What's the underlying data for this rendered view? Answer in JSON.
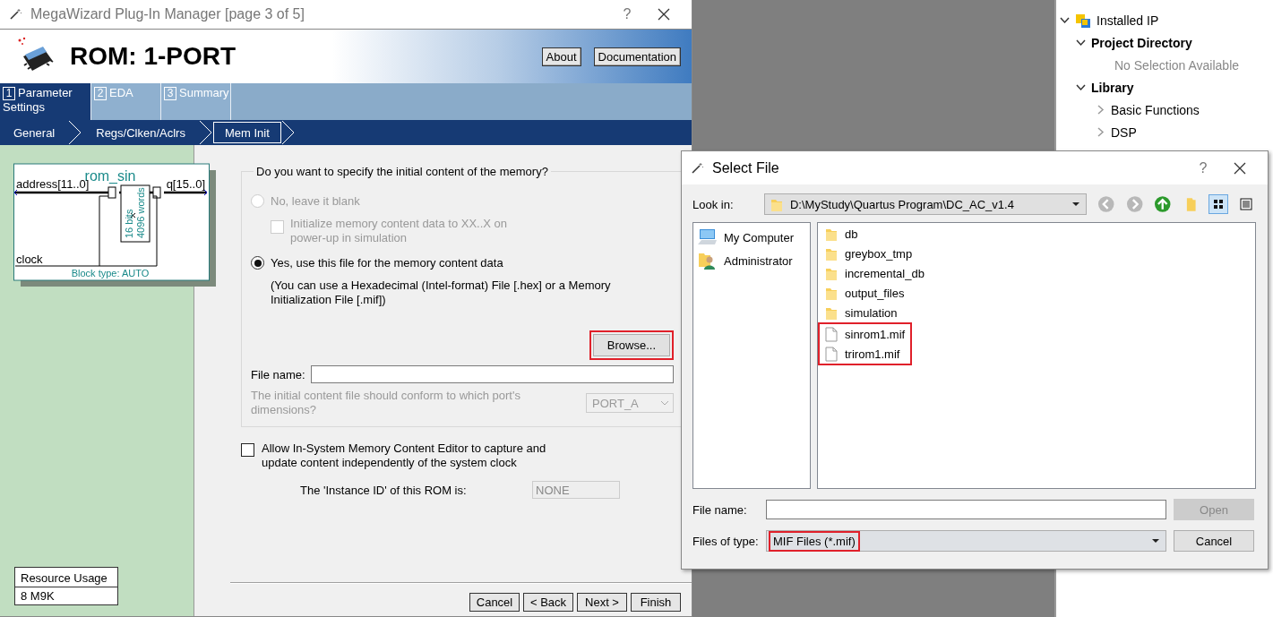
{
  "wizard": {
    "title": "MegaWizard Plug-In Manager [page 3 of 5]",
    "help": "?",
    "heading": "ROM: 1-PORT",
    "header_buttons": [
      {
        "label": "About"
      },
      {
        "label": "Documentation"
      }
    ],
    "tabs": [
      {
        "number": "1",
        "label": "Parameter Settings",
        "selected": true
      },
      {
        "number": "2",
        "label": "EDA",
        "selected": false
      },
      {
        "number": "3",
        "label": "Summary",
        "selected": false
      }
    ],
    "steps": [
      {
        "label": "General",
        "selected": false
      },
      {
        "label": "Regs/Clken/Aclrs",
        "selected": false
      },
      {
        "label": "Mem Init",
        "selected": true
      }
    ],
    "symbol": {
      "name": "rom_sin",
      "input": "address[11..0]",
      "output": "q[15..0]",
      "clock": "clock",
      "width_label": "16 bits",
      "depth_label": "4096 words",
      "block_type": "Block type: AUTO"
    },
    "resource": {
      "title": "Resource Usage",
      "value": "8 M9K"
    },
    "mem_init": {
      "question": "Do you want to specify the initial content of the memory?",
      "options": [
        {
          "label": "No, leave it blank",
          "selected": false,
          "disabled": true
        },
        {
          "label": "Yes, use this file for the memory content data",
          "selected": true,
          "disabled": false
        }
      ],
      "blank_option": {
        "label": "Initialize memory content data to XX..X on power-up in simulation",
        "checked": false,
        "disabled": true
      },
      "hint": "(You can use a Hexadecimal (Intel-format) File [.hex] or a Memory Initialization File [.mif])",
      "browse": {
        "label": "Browse...",
        "highlighted": true
      },
      "file_name_label": "File name:",
      "port_question": "The initial content file should conform to which port's dimensions?",
      "port": {
        "value": "PORT_A",
        "disabled": true
      }
    },
    "in_system": {
      "label": "Allow In-System Memory Content Editor to capture and update content independently of the system clock",
      "checked": false
    },
    "instance_id": {
      "label": "The 'Instance ID' of this ROM is:",
      "value": "NONE",
      "disabled": true
    },
    "footer_buttons": [
      {
        "label": "Cancel"
      },
      {
        "label": "< Back"
      },
      {
        "label": "Next >"
      },
      {
        "label": "Finish"
      }
    ]
  },
  "ip_panel": {
    "tree": [
      {
        "label": "Installed IP",
        "expanded": true,
        "children": [
          {
            "label": "Project Directory",
            "expanded": true,
            "children": [
              {
                "label": "No Selection Available",
                "kind": "note"
              }
            ]
          },
          {
            "label": "Library",
            "expanded": true,
            "children": [
              {
                "label": "Basic Functions",
                "expanded": false
              },
              {
                "label": "DSP",
                "expanded": false
              }
            ]
          }
        ]
      }
    ]
  },
  "select_file": {
    "title": "Select File",
    "help": "?",
    "look_in_label": "Look in:",
    "path": "D:\\MyStudy\\Quartus Program\\DC_AC_v1.4",
    "nav": [
      {
        "kind": "back",
        "disabled": true
      },
      {
        "kind": "forward",
        "disabled": true
      },
      {
        "kind": "up",
        "disabled": false
      },
      {
        "kind": "new-folder",
        "disabled": false
      }
    ],
    "views": [
      {
        "kind": "icons",
        "selected": true
      },
      {
        "kind": "details",
        "selected": false
      }
    ],
    "places": [
      {
        "label": "My Computer",
        "kind": "computer"
      },
      {
        "label": "Administrator",
        "kind": "user"
      }
    ],
    "files": [
      {
        "name": "db",
        "kind": "folder",
        "highlighted": false
      },
      {
        "name": "greybox_tmp",
        "kind": "folder",
        "highlighted": false
      },
      {
        "name": "incremental_db",
        "kind": "folder",
        "highlighted": false
      },
      {
        "name": "output_files",
        "kind": "folder",
        "highlighted": false
      },
      {
        "name": "simulation",
        "kind": "folder",
        "highlighted": false
      },
      {
        "name": "sinrom1.mif",
        "kind": "file",
        "highlighted": true
      },
      {
        "name": "trirom1.mif",
        "kind": "file",
        "highlighted": true
      }
    ],
    "file_name_label": "File name:",
    "type_label": "Files of type:",
    "file_type": {
      "value": "MIF Files (*.mif)",
      "highlighted": true
    },
    "buttons": [
      {
        "label": "Open",
        "disabled": true
      },
      {
        "label": "Cancel",
        "disabled": false
      }
    ]
  }
}
